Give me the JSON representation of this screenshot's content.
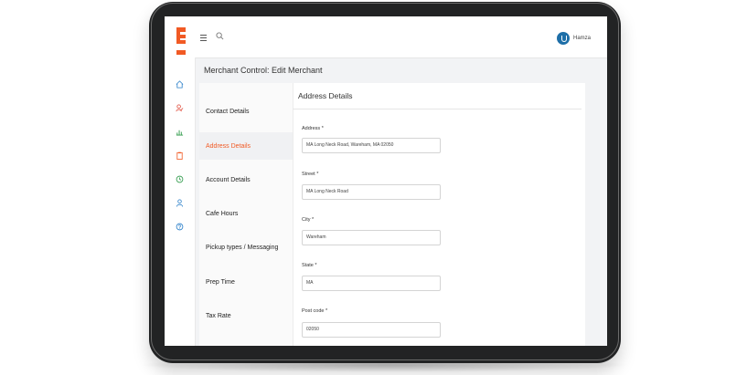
{
  "user": {
    "name": "Hamza"
  },
  "page": {
    "title": "Merchant Control: Edit Merchant"
  },
  "tabs": [
    {
      "label": "Contact Details",
      "active": false
    },
    {
      "label": "Address Details",
      "active": true
    },
    {
      "label": "Account Details",
      "active": false
    },
    {
      "label": "Cafe Hours",
      "active": false
    },
    {
      "label": "Pickup types / Messaging",
      "active": false
    },
    {
      "label": "Prep Time",
      "active": false
    },
    {
      "label": "Tax Rate",
      "active": false
    }
  ],
  "section": {
    "title": "Address Details"
  },
  "fields": [
    {
      "label": "Address *",
      "value": "MA Long Neck Road, Wareham, MA 02050"
    },
    {
      "label": "Street *",
      "value": "MA Long Neck Road"
    },
    {
      "label": "City *",
      "value": "Wareham"
    },
    {
      "label": "State *",
      "value": "MA"
    },
    {
      "label": "Post code *",
      "value": "02050"
    }
  ],
  "colors": {
    "accent": "#f15a24",
    "rail_icon": "#2a7fc9"
  },
  "icons": [
    "home-icon",
    "user-edit-icon",
    "chart-icon",
    "clipboard-icon",
    "clock-icon",
    "person-icon",
    "help-icon"
  ]
}
